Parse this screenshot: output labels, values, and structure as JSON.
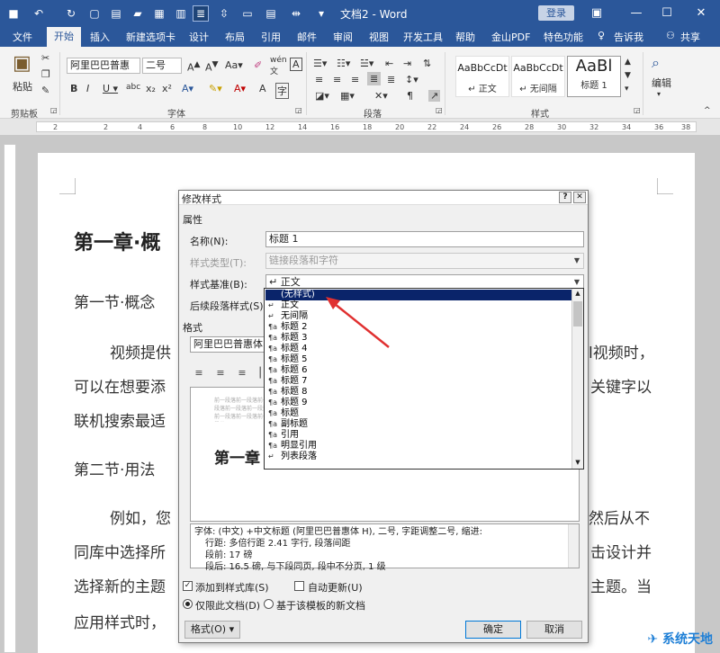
{
  "window": {
    "title": "文档2 - Word",
    "login": "登录",
    "share": "共享"
  },
  "colors": {
    "ribbon_blue": "#2b579a",
    "selection": "#0a246a",
    "arrow": "#e03030"
  },
  "tabs": [
    "文件",
    "开始",
    "插入",
    "新建选项卡",
    "设计",
    "布局",
    "引用",
    "邮件",
    "审阅",
    "视图",
    "开发工具",
    "帮助",
    "金山PDF",
    "特色功能",
    "告诉我"
  ],
  "ribbon": {
    "paste": "粘贴",
    "clipboard": "剪贴板",
    "font_name": "阿里巴巴普惠",
    "font_size": "二号",
    "font_group": "字体",
    "paragraph_group": "段落",
    "styles_group": "样式",
    "styles": [
      {
        "sample": "AaBbCcDt",
        "name": "↵ 正文"
      },
      {
        "sample": "AaBbCcDt",
        "name": "↵ 无间隔"
      },
      {
        "sample": "AaBl",
        "name": "标题 1"
      }
    ],
    "edit": "编辑"
  },
  "ruler": [
    "2",
    "2",
    "4",
    "6",
    "8",
    "10",
    "12",
    "14",
    "16",
    "18",
    "20",
    "22",
    "24",
    "26",
    "28",
    "30",
    "32",
    "34",
    "36",
    "38"
  ],
  "document": {
    "h1": "第一章·概",
    "sec1": "第一节·概念",
    "p1a": "视频提供",
    "p1a_r": "l视频时，",
    "p1b": "可以在想要添",
    "p1b_r": "关键字以",
    "p1c": "联机搜索最适",
    "sec2": "第二节·用法",
    "p2a": "例如，您",
    "p2a_r": "然后从不",
    "p2b": "同库中选择所",
    "p2b_r": "击设计并",
    "p2c": "选择新的主题",
    "p2c_r": "主题。当",
    "p2d": "应用样式时，"
  },
  "dialog": {
    "title": "修改样式",
    "props": "属性",
    "name_label": "名称(N):",
    "name_value": "标题 1",
    "type_label": "样式类型(T):",
    "type_value": "链接段落和字符",
    "based_label": "样式基准(B):",
    "based_value": "↵ 正文",
    "next_label": "后续段落样式(S):",
    "format_section": "格式",
    "font_value": "阿里巴巴普惠体",
    "preview_prev": "前一段落前一段落前一段落前一段落前一段落前一段落前一段落前一段落",
    "preview_heading": "第一章",
    "description": [
      "字体: (中文) +中文标题 (阿里巴巴普惠体 H), 二号, 字距调整二号, 缩进:",
      "行距: 多倍行距 2.41 字行, 段落间距",
      "段前: 17 磅",
      "段后: 16.5 磅, 与下段同页, 段中不分页, 1 级"
    ],
    "add_gallery": "添加到样式库(S)",
    "auto_update": "自动更新(U)",
    "only_doc": "仅限此文档(D)",
    "new_docs": "基于该模板的新文档",
    "format_btn": "格式(O) ▾",
    "ok": "确定",
    "cancel": "取消"
  },
  "dropdown": {
    "selected": "(无样式)",
    "items": [
      {
        "icon": "↵",
        "label": "正文"
      },
      {
        "icon": "↵",
        "label": "无间隔"
      },
      {
        "icon": "¶a",
        "label": "标题 2"
      },
      {
        "icon": "¶a",
        "label": "标题 3"
      },
      {
        "icon": "¶a",
        "label": "标题 4"
      },
      {
        "icon": "¶a",
        "label": "标题 5"
      },
      {
        "icon": "¶a",
        "label": "标题 6"
      },
      {
        "icon": "¶a",
        "label": "标题 7"
      },
      {
        "icon": "¶a",
        "label": "标题 8"
      },
      {
        "icon": "¶a",
        "label": "标题 9"
      },
      {
        "icon": "¶a",
        "label": "标题"
      },
      {
        "icon": "¶a",
        "label": "副标题"
      },
      {
        "icon": "¶a",
        "label": "引用"
      },
      {
        "icon": "¶a",
        "label": "明显引用"
      },
      {
        "icon": "↵",
        "label": "列表段落"
      }
    ]
  },
  "watermark": "系统天地"
}
